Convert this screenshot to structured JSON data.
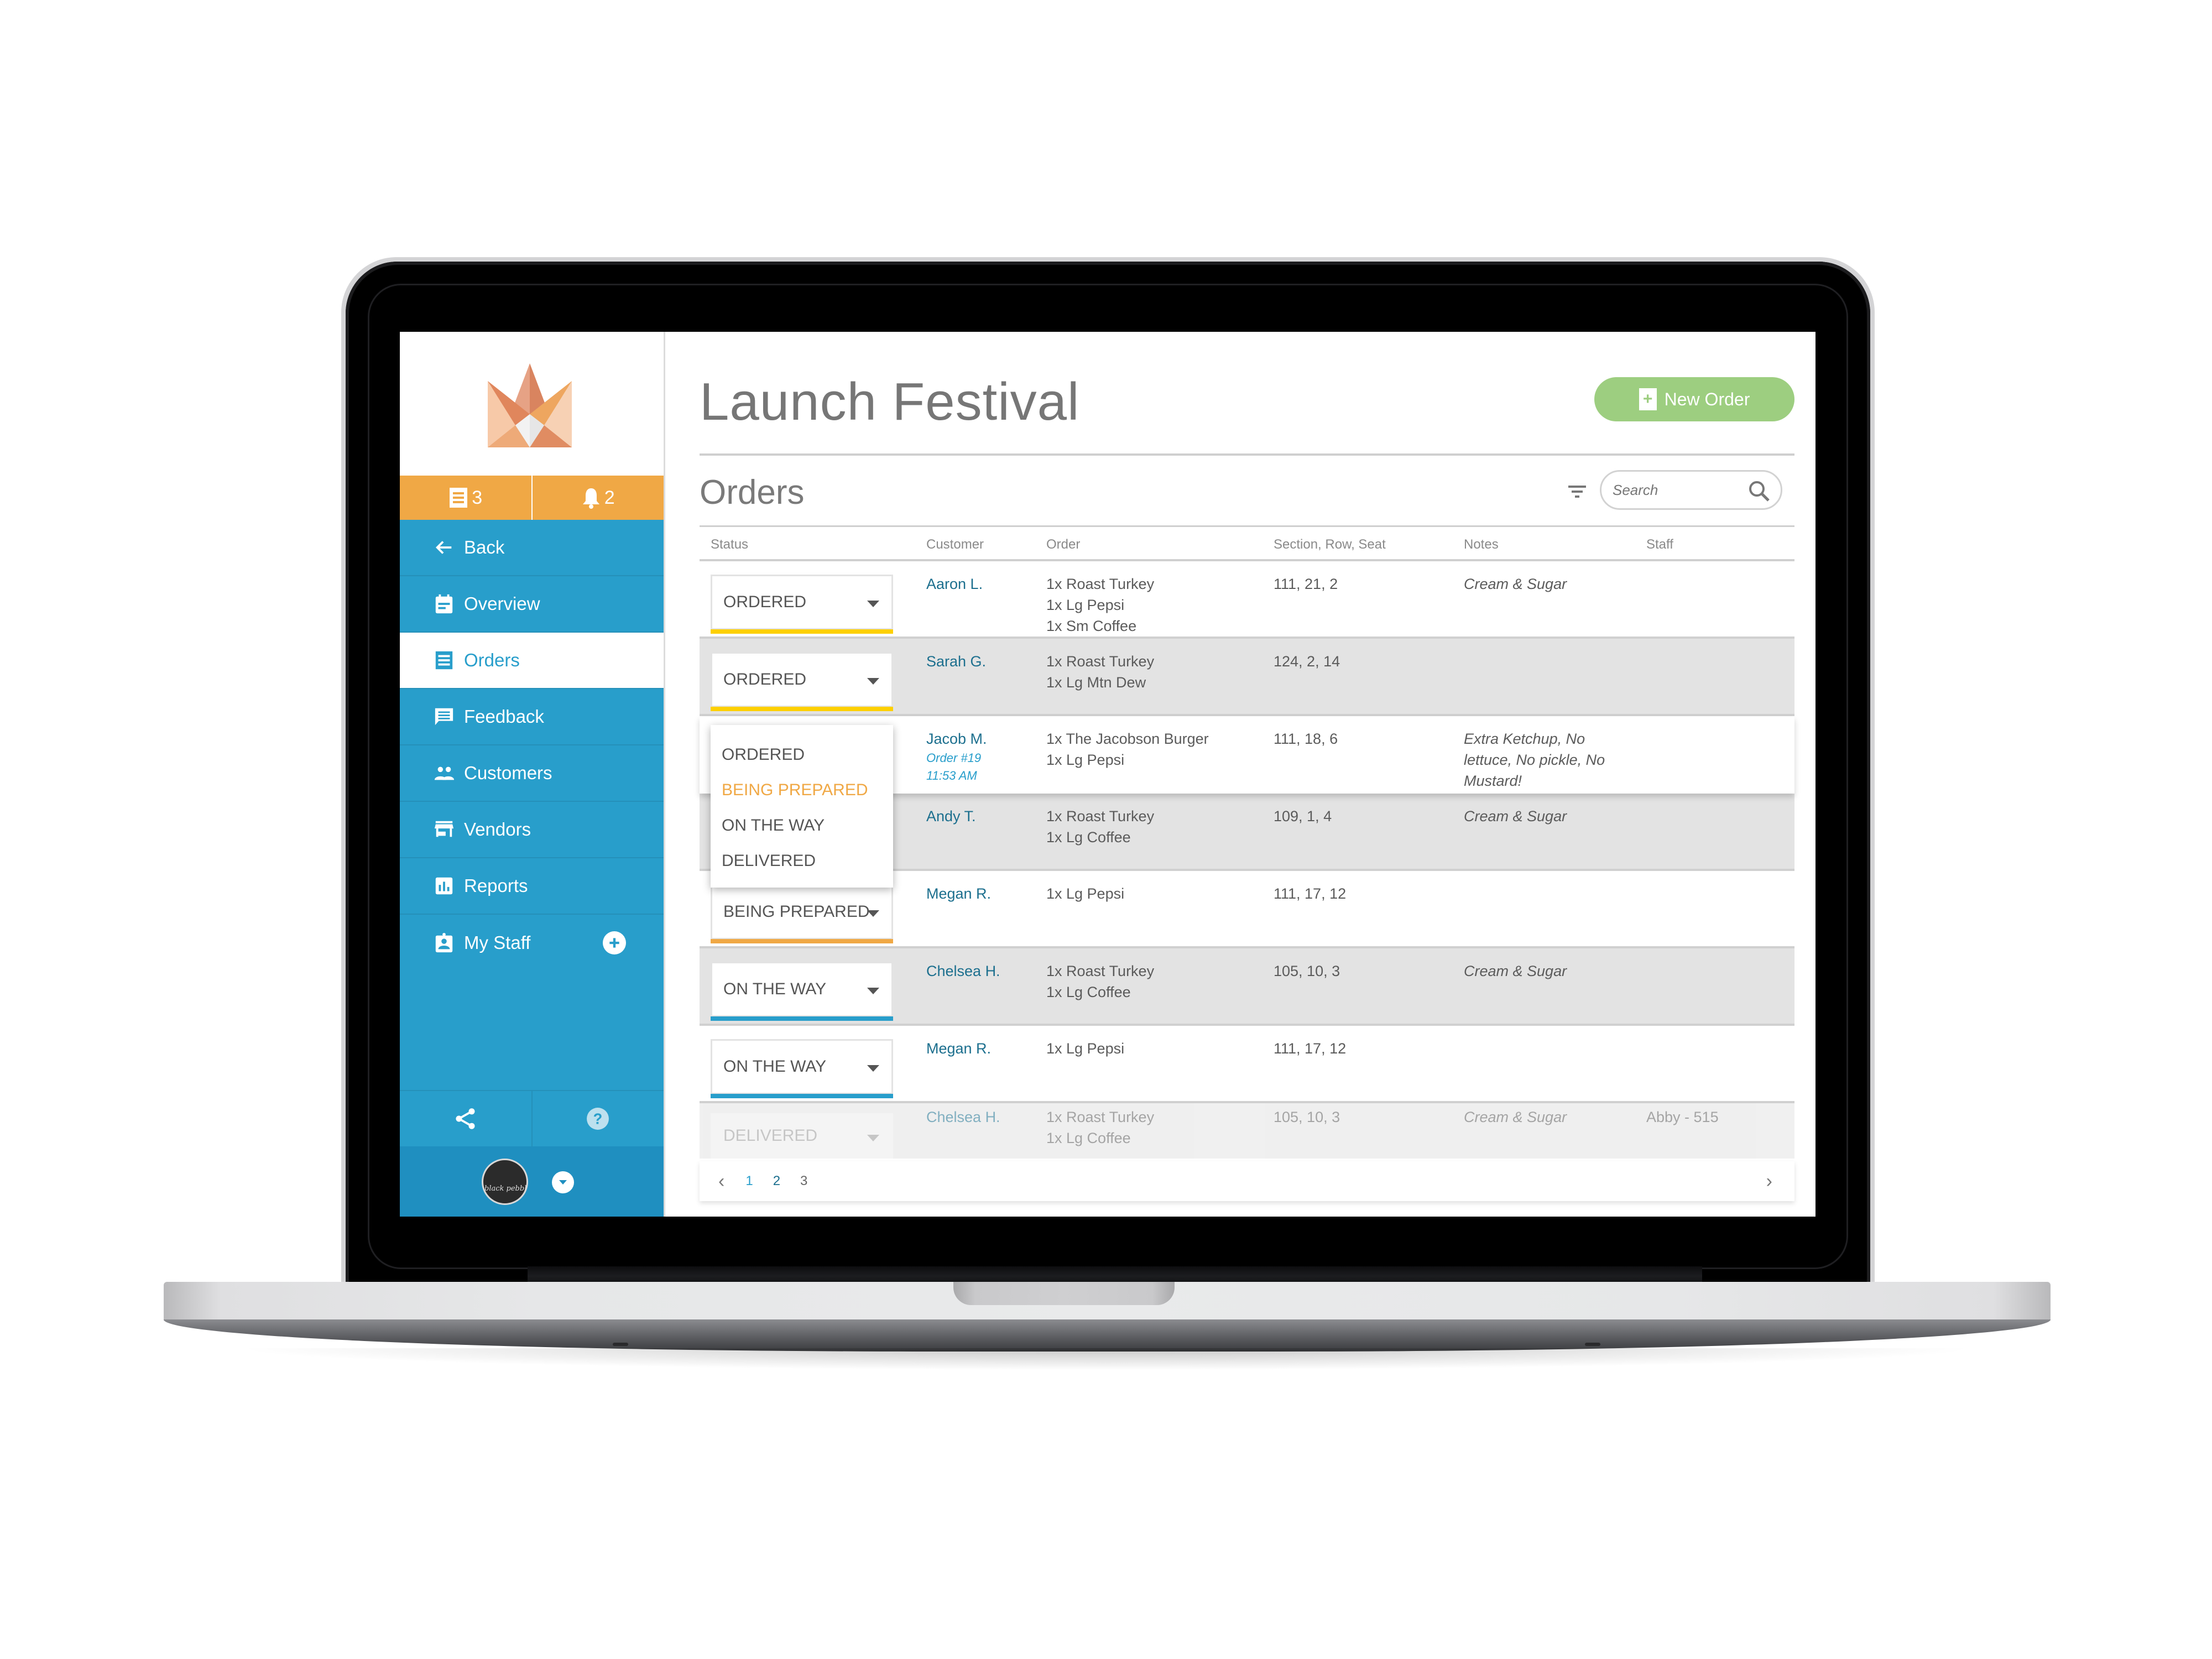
{
  "app": {
    "event_title": "Launch Festival",
    "section_title": "Orders",
    "brand_colors": {
      "sidebar_blue": "#289ecb",
      "counter_orange": "#f0a845",
      "new_order_green": "#9dce80",
      "status_ordered": "#fdd000",
      "status_being_prepared": "#f0a845",
      "status_on_the_way": "#289ecb"
    }
  },
  "sidebar": {
    "counters": [
      {
        "icon": "receipt-icon",
        "value": "3"
      },
      {
        "icon": "bell-icon",
        "value": "2"
      }
    ],
    "items": [
      {
        "label": "Back",
        "icon": "arrow-left-icon",
        "active": false
      },
      {
        "label": "Overview",
        "icon": "calendar-icon",
        "active": false
      },
      {
        "label": "Orders",
        "icon": "receipt-icon",
        "active": true
      },
      {
        "label": "Feedback",
        "icon": "chat-icon",
        "active": false
      },
      {
        "label": "Customers",
        "icon": "people-icon",
        "active": false
      },
      {
        "label": "Vendors",
        "icon": "store-icon",
        "active": false
      },
      {
        "label": "Reports",
        "icon": "bar-chart-icon",
        "active": false
      },
      {
        "label": "My Staff",
        "icon": "badge-icon",
        "active": false
      }
    ],
    "bottom_icons": [
      "share-icon",
      "help-icon"
    ],
    "profile": {
      "avatar_text": "black pebble"
    }
  },
  "toolbar": {
    "new_order_label": "New Order",
    "search_placeholder": "Search"
  },
  "table": {
    "columns": [
      "Status",
      "Customer",
      "Order",
      "Section, Row, Seat",
      "Notes",
      "Staff"
    ],
    "status_options": [
      "ORDERED",
      "BEING PREPARED",
      "ON THE WAY",
      "DELIVERED"
    ],
    "dropdown_highlighted": "BEING PREPARED",
    "rows": [
      {
        "status": "ORDERED",
        "customer": "Aaron L.",
        "order": [
          "1x Roast Turkey",
          "1x Lg Pepsi",
          "1x Sm Coffee"
        ],
        "seat": "111, 21, 2",
        "notes": "Cream & Sugar",
        "staff": ""
      },
      {
        "status": "ORDERED",
        "customer": "Sarah G.",
        "order": [
          "1x Roast Turkey",
          "1x Lg Mtn Dew"
        ],
        "seat": "124, 2, 14",
        "notes": "",
        "staff": ""
      },
      {
        "status": "ORDERED",
        "customer": "Jacob M.",
        "order_number": "Order #19",
        "time": "11:53 AM",
        "order": [
          "1x The Jacobson Burger",
          "1x Lg Pepsi"
        ],
        "seat": "111, 18, 6",
        "notes": "Extra Ketchup, No lettuce, No pickle, No Mustard!",
        "staff": "",
        "dropdown_open": true
      },
      {
        "status": "",
        "customer": "Andy T.",
        "order": [
          "1x Roast Turkey",
          "1x Lg Coffee"
        ],
        "seat": "109, 1, 4",
        "notes": "Cream & Sugar",
        "staff": ""
      },
      {
        "status": "BEING PREPARED",
        "customer": "Megan R.",
        "order": [
          "1x Lg Pepsi"
        ],
        "seat": "111, 17, 12",
        "notes": "",
        "staff": ""
      },
      {
        "status": "ON THE WAY",
        "customer": "Chelsea H.",
        "order": [
          "1x Roast Turkey",
          "1x Lg Coffee"
        ],
        "seat": "105, 10, 3",
        "notes": "Cream & Sugar",
        "staff": ""
      },
      {
        "status": "ON THE WAY",
        "customer": "Megan R.",
        "order": [
          "1x Lg Pepsi"
        ],
        "seat": "111, 17, 12",
        "notes": "",
        "staff": ""
      },
      {
        "status": "DELIVERED",
        "customer": "Chelsea H.",
        "order": [
          "1x Roast Turkey",
          "1x Lg Coffee"
        ],
        "seat": "105, 10, 3",
        "notes": "Cream & Sugar",
        "staff": "Abby - 515"
      }
    ]
  },
  "pagination": {
    "pages": [
      "1",
      "2",
      "3"
    ],
    "current": "2"
  }
}
